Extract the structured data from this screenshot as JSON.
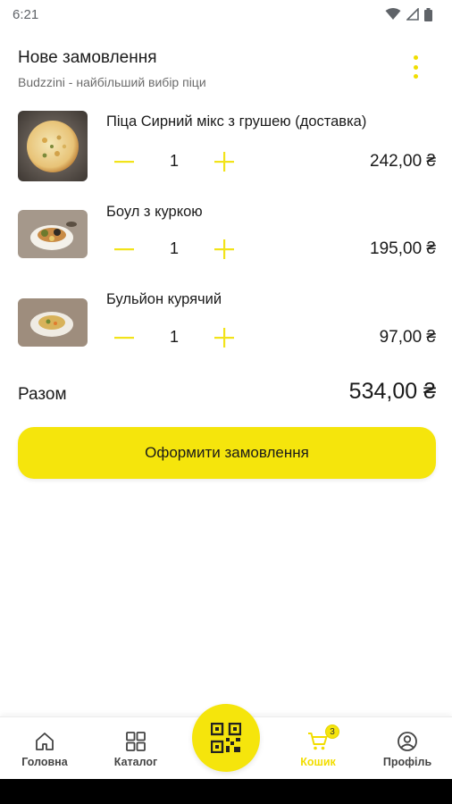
{
  "status_bar": {
    "time": "6:21"
  },
  "header": {
    "title": "Нове замовлення",
    "subtitle": "Budzzini - найбільший вибір піци"
  },
  "cart_items": [
    {
      "name": "Піца Сирний мікс з грушею (доставка)",
      "quantity": "1",
      "price": "242,00 ₴"
    },
    {
      "name": "Боул з куркою",
      "quantity": "1",
      "price": "195,00 ₴"
    },
    {
      "name": "Бульйон курячий",
      "quantity": "1",
      "price": "97,00 ₴"
    }
  ],
  "total": {
    "label": "Разом",
    "value": "534,00 ₴"
  },
  "checkout": {
    "label": "Оформити замовлення"
  },
  "bottom_nav": {
    "items": [
      {
        "label": "Головна",
        "icon": "home-icon"
      },
      {
        "label": "Каталог",
        "icon": "grid-icon"
      },
      {
        "label": "Кошик",
        "icon": "cart-icon",
        "badge": "3",
        "active": true
      },
      {
        "label": "Профіль",
        "icon": "profile-icon"
      }
    ],
    "center_icon": "qr-code-icon"
  },
  "colors": {
    "accent": "#f5e50c",
    "text": "#1a1a1a",
    "muted": "#6b6b6b"
  }
}
